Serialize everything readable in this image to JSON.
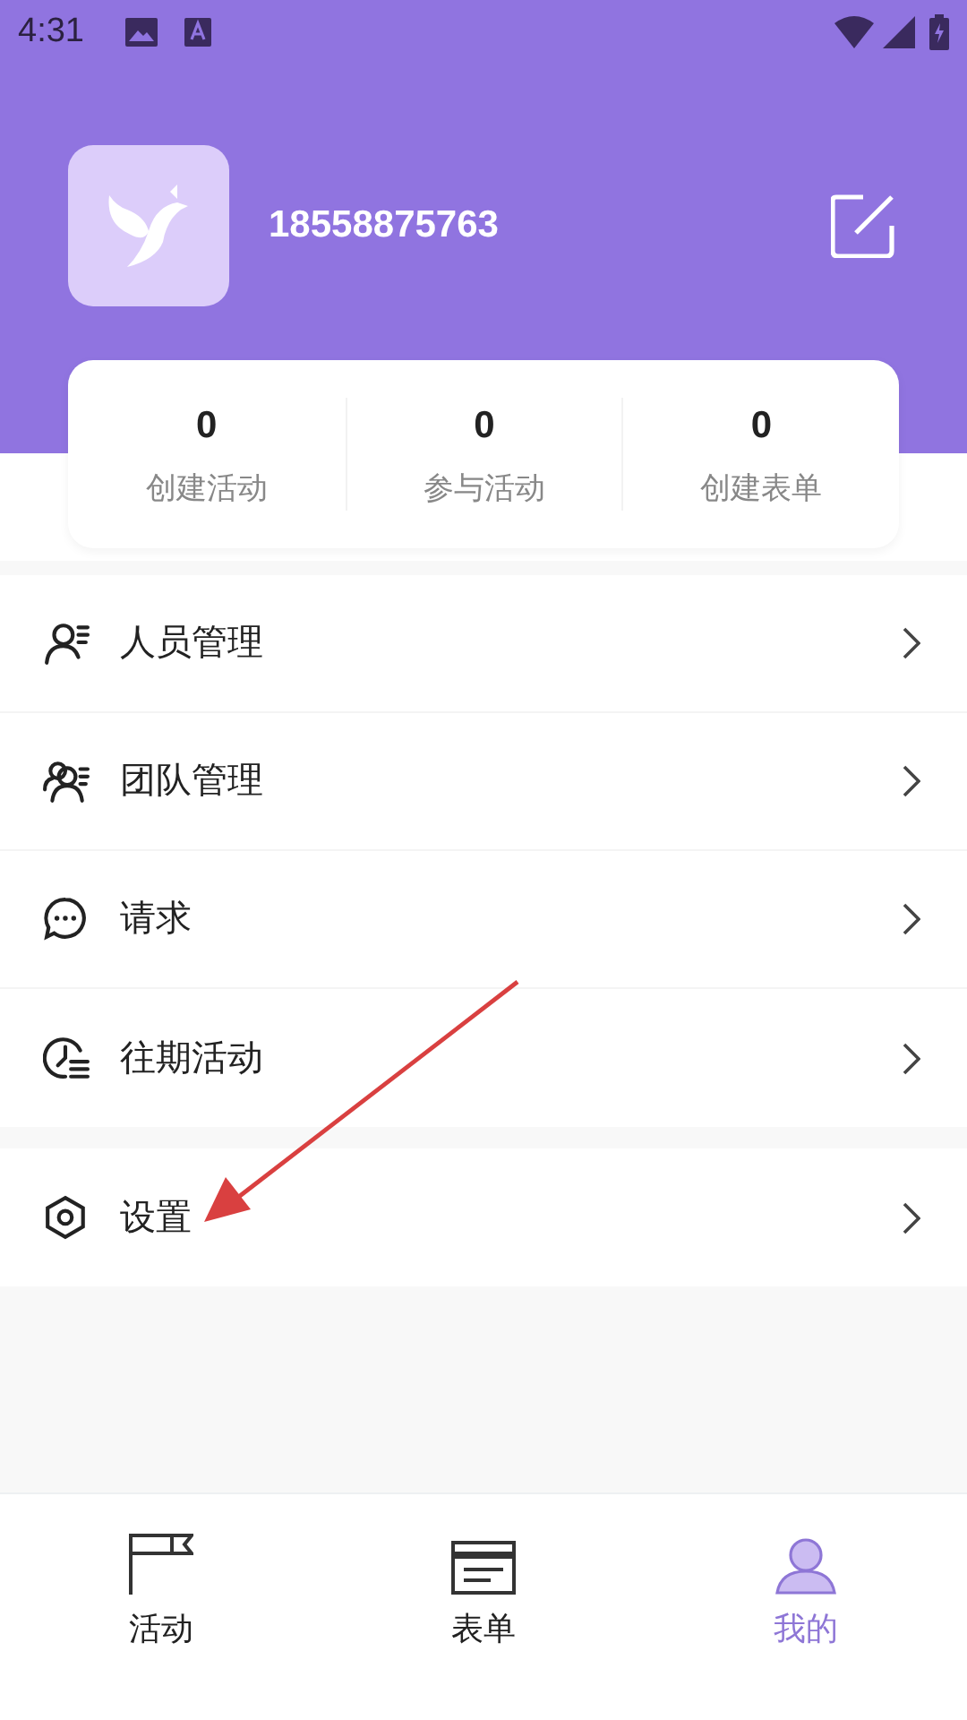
{
  "status_bar": {
    "time": "4:31"
  },
  "profile": {
    "phone": "18558875763"
  },
  "stats": [
    {
      "value": "0",
      "label": "创建活动"
    },
    {
      "value": "0",
      "label": "参与活动"
    },
    {
      "value": "0",
      "label": "创建表单"
    }
  ],
  "menu_groups": [
    {
      "items": [
        {
          "label": "人员管理"
        },
        {
          "label": "团队管理"
        },
        {
          "label": "请求"
        },
        {
          "label": "往期活动"
        }
      ]
    },
    {
      "items": [
        {
          "label": "设置"
        }
      ]
    }
  ],
  "bottom_tabs": [
    {
      "label": "活动",
      "selected": false
    },
    {
      "label": "表单",
      "selected": false
    },
    {
      "label": "我的",
      "selected": true
    }
  ]
}
